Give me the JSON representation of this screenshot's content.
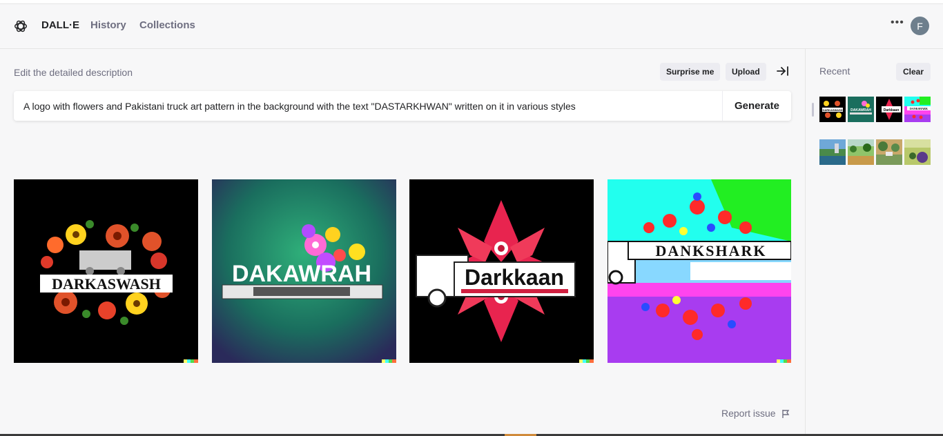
{
  "header": {
    "brand": "DALL·E",
    "nav": [
      "History",
      "Collections"
    ],
    "more_icon": "ellipsis-icon",
    "avatar_letter": "F"
  },
  "editor": {
    "label": "Edit the detailed description",
    "surprise_label": "Surprise me",
    "upload_label": "Upload",
    "collapse_icon": "collapse-right-icon",
    "prompt_value": "A logo with flowers and Pakistani truck art pattern in the background with the text \"DASTARKHWAN\" written on it in various styles",
    "generate_label": "Generate"
  },
  "results": [
    {
      "text": "DARKASWASH",
      "background": "#000000"
    },
    {
      "text": "DAKAWRAH",
      "background": "#1e8a5e"
    },
    {
      "text": "Darkkaan",
      "background": "#000000"
    },
    {
      "text": "DANKSHARK",
      "background": "#ff44ee"
    }
  ],
  "footer": {
    "report_label": "Report issue",
    "report_icon": "flag-icon"
  },
  "sidebar": {
    "recent_label": "Recent",
    "clear_label": "Clear",
    "thumbnails": [
      {
        "text": "DARKASWASH"
      },
      {
        "text": "DAKAWRAH"
      },
      {
        "text": "Darkkaan"
      },
      {
        "text": "DANKSHARK"
      },
      {
        "text": ""
      },
      {
        "text": ""
      },
      {
        "text": ""
      },
      {
        "text": ""
      }
    ]
  },
  "colors": {
    "background": "#f7f7f8",
    "text": "#202123",
    "muted": "#6e6e80",
    "pill": "#ececf1"
  }
}
